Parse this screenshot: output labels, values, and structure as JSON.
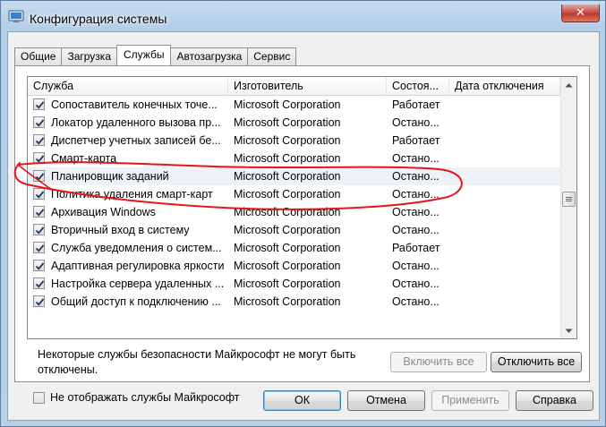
{
  "window": {
    "title": "Конфигурация системы",
    "close_glyph": "✕"
  },
  "tabs": [
    {
      "label": "Общие",
      "active": false
    },
    {
      "label": "Загрузка",
      "active": false
    },
    {
      "label": "Службы",
      "active": true
    },
    {
      "label": "Автозагрузка",
      "active": false
    },
    {
      "label": "Сервис",
      "active": false
    }
  ],
  "services": {
    "columns": [
      "Служба",
      "Изготовитель",
      "Состоя...",
      "Дата отключения"
    ],
    "rows": [
      {
        "name": "Сопоставитель конечных точе...",
        "vendor": "Microsoft Corporation",
        "status": "Работает",
        "date": "",
        "checked": true
      },
      {
        "name": "Локатор удаленного вызова пр...",
        "vendor": "Microsoft Corporation",
        "status": "Остано...",
        "date": "",
        "checked": true
      },
      {
        "name": "Диспетчер учетных записей бе...",
        "vendor": "Microsoft Corporation",
        "status": "Работает",
        "date": "",
        "checked": true
      },
      {
        "name": "Смарт-карта",
        "vendor": "Microsoft Corporation",
        "status": "Остано...",
        "date": "",
        "checked": true
      },
      {
        "name": "Планировщик заданий",
        "vendor": "Microsoft Corporation",
        "status": "Остано...",
        "date": "",
        "checked": true
      },
      {
        "name": "Политика удаления смарт-карт",
        "vendor": "Microsoft Corporation",
        "status": "Остано...",
        "date": "",
        "checked": true
      },
      {
        "name": "Архивация Windows",
        "vendor": "Microsoft Corporation",
        "status": "Остано...",
        "date": "",
        "checked": true
      },
      {
        "name": "Вторичный вход в систему",
        "vendor": "Microsoft Corporation",
        "status": "Остано...",
        "date": "",
        "checked": true
      },
      {
        "name": "Служба уведомления о систем...",
        "vendor": "Microsoft Corporation",
        "status": "Работает",
        "date": "",
        "checked": true
      },
      {
        "name": "Адаптивная регулировка яркости",
        "vendor": "Microsoft Corporation",
        "status": "Остано...",
        "date": "",
        "checked": true
      },
      {
        "name": "Настройка сервера удаленных ...",
        "vendor": "Microsoft Corporation",
        "status": "Остано...",
        "date": "",
        "checked": true
      },
      {
        "name": "Общий доступ к подключению ...",
        "vendor": "Microsoft Corporation",
        "status": "Остано...",
        "date": "",
        "checked": true
      }
    ],
    "highlighted_row": 4
  },
  "note": "Некоторые службы безопасности Майкрософт не могут быть отключены.",
  "buttons": {
    "enable_all": "Включить все",
    "disable_all": "Отключить все",
    "ok": "ОК",
    "cancel": "Отмена",
    "apply": "Применить",
    "help": "Справка"
  },
  "hide_ms": {
    "label": "Не отображать службы Майкрософт",
    "checked": false
  },
  "colors": {
    "annotation": "#e8141b",
    "title_bar": "#b5cfe8",
    "close_button": "#c75050"
  }
}
